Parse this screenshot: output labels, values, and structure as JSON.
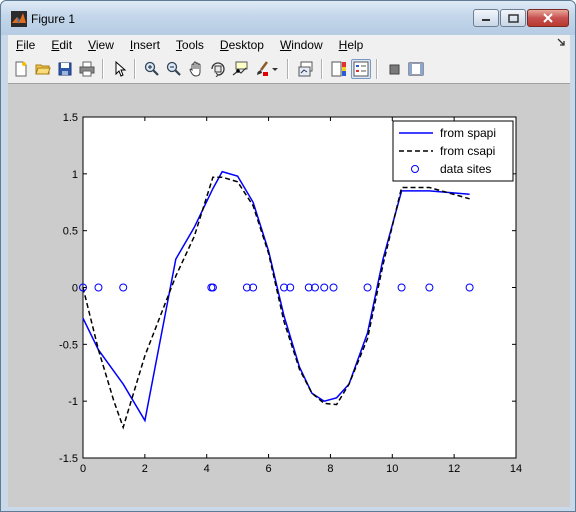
{
  "window": {
    "title": "Figure 1"
  },
  "menu": [
    "File",
    "Edit",
    "View",
    "Insert",
    "Tools",
    "Desktop",
    "Window",
    "Help"
  ],
  "menu_underline": [
    "F",
    "E",
    "V",
    "I",
    "T",
    "D",
    "W",
    "H"
  ],
  "toolbar": [
    "new-figure",
    "open-file",
    "save-figure",
    "print-figure",
    "edit-plot-arrow",
    "zoom-in",
    "zoom-out",
    "pan-hand",
    "rotate-3d",
    "data-cursor",
    "brush",
    "link-plot",
    "colorbar",
    "legend",
    "hide-plot-tools",
    "show-plot-tools"
  ],
  "colors": {
    "spapi": "#0000ff",
    "csapi": "#000000",
    "sites": "#0000ff",
    "figure_bg": "#cccccc"
  },
  "chart_data": {
    "type": "line",
    "xlim": [
      0,
      14
    ],
    "ylim": [
      -1.5,
      1.5
    ],
    "xticks": [
      0,
      2,
      4,
      6,
      8,
      10,
      12,
      14
    ],
    "yticks": [
      -1.5,
      -1,
      -0.5,
      0,
      0.5,
      1,
      1.5
    ],
    "xtick_labels": [
      "0",
      "2",
      "4",
      "6",
      "8",
      "10",
      "12",
      "14"
    ],
    "ytick_labels": [
      "-1.5",
      "-1",
      "-0.5",
      "0",
      "0.5",
      "1",
      "1.5"
    ],
    "grid": false,
    "legend_position": "top-right",
    "series": [
      {
        "name": "from spapi",
        "style": "solid",
        "x": [
          0,
          0.5,
          1.3,
          2.0,
          3.0,
          3.6,
          4.2,
          4.5,
          5.0,
          5.5,
          6.0,
          6.5,
          7.0,
          7.4,
          7.8,
          8.2,
          8.6,
          9.2,
          9.7,
          10.3,
          11.2,
          12.5
        ],
        "y": [
          -0.27,
          -0.55,
          -0.85,
          -1.17,
          0.25,
          0.53,
          0.87,
          1.02,
          0.98,
          0.75,
          0.32,
          -0.25,
          -0.7,
          -0.93,
          -1.0,
          -0.97,
          -0.85,
          -0.4,
          0.25,
          0.85,
          0.85,
          0.82
        ]
      },
      {
        "name": "from csapi",
        "style": "dashed",
        "x": [
          0,
          0.5,
          1.0,
          1.3,
          2.0,
          3.0,
          3.6,
          4.2,
          4.5,
          5.0,
          5.5,
          6.0,
          6.5,
          7.0,
          7.4,
          7.8,
          8.2,
          8.6,
          9.2,
          9.7,
          10.3,
          11.2,
          12.5
        ],
        "y": [
          0,
          -0.55,
          -1.0,
          -1.23,
          -0.6,
          0.1,
          0.45,
          0.97,
          0.97,
          0.93,
          0.72,
          0.3,
          -0.3,
          -0.72,
          -0.93,
          -1.02,
          -1.03,
          -0.85,
          -0.45,
          0.2,
          0.88,
          0.88,
          0.78
        ]
      }
    ],
    "data_sites": {
      "name": "data sites",
      "x": [
        0,
        0.5,
        1.3,
        4.15,
        4.2,
        5.3,
        5.5,
        6.5,
        6.7,
        7.3,
        7.5,
        7.8,
        8.1,
        9.2,
        10.3,
        11.2,
        12.5
      ],
      "y": [
        0,
        0,
        0,
        0,
        0,
        0,
        0,
        0,
        0,
        0,
        0,
        0,
        0,
        0,
        0,
        0,
        0
      ]
    }
  }
}
